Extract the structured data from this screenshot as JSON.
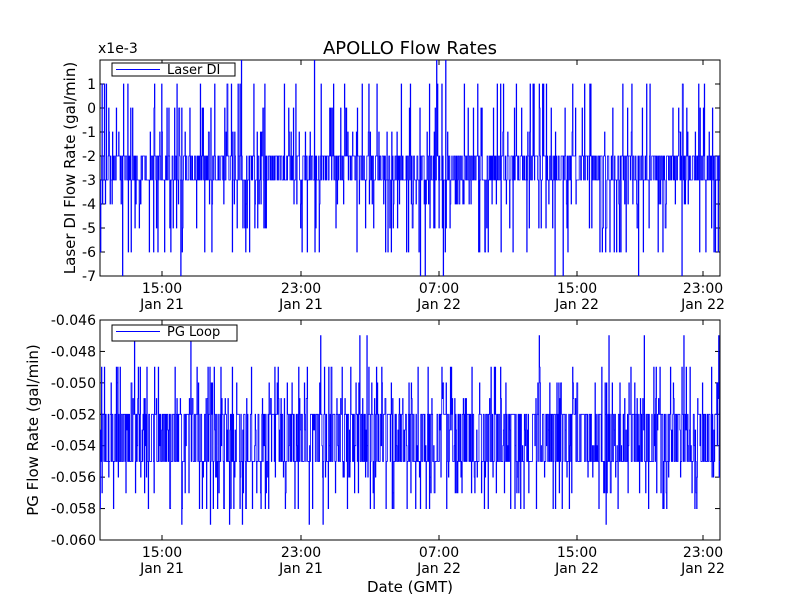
{
  "figure_title": "APOLLO Flow Rates",
  "colors": {
    "line": "#0000ff",
    "axes": "#000000",
    "background": "#ffffff"
  },
  "chart_data": [
    {
      "type": "line",
      "title": "APOLLO Flow Rates",
      "xlabel": "",
      "ylabel": "Laser DI Flow Rate (gal/min)",
      "y_scale_label": "x1e-3",
      "ylim": [
        -7,
        2
      ],
      "y_ticks": [
        1,
        0,
        -1,
        -2,
        -3,
        -4,
        -5,
        -6,
        -7
      ],
      "y_tick_labels": [
        "1",
        "0",
        "-1",
        "-2",
        "-3",
        "-4",
        "-5",
        "-6",
        "-7"
      ],
      "x_range": [
        "Jan 21 11:00",
        "Jan 22 23:30"
      ],
      "x_ticks": [
        {
          "time": "15:00",
          "date": "Jan 21"
        },
        {
          "time": "23:00",
          "date": "Jan 21"
        },
        {
          "time": "07:00",
          "date": "Jan 22"
        },
        {
          "time": "15:00",
          "date": "Jan 22"
        },
        {
          "time": "23:00",
          "date": "Jan 22"
        }
      ],
      "legend": {
        "placement": "top-left",
        "entries": [
          "Laser DI"
        ]
      },
      "grid": false,
      "series": [
        {
          "name": "Laser DI",
          "baseline_low": -3,
          "baseline_high": -2,
          "min": -7,
          "max": 2,
          "typical_values": [
            -2,
            -3,
            -1,
            -4,
            0,
            -2,
            -3,
            -5,
            1,
            -6
          ],
          "notes_from_plot": "noisy step signal oscillating mostly between -2 and -3 (x1e-3), spikes to 0/1 and dips to -6/-7"
        }
      ]
    },
    {
      "type": "line",
      "title": "",
      "xlabel": "Date (GMT)",
      "ylabel": "PG Flow Rate (gal/min)",
      "ylim": [
        -0.06,
        -0.046
      ],
      "y_ticks": [
        -0.046,
        -0.048,
        -0.05,
        -0.052,
        -0.054,
        -0.056,
        -0.058,
        -0.06
      ],
      "y_tick_labels": [
        "-0.046",
        "-0.048",
        "-0.050",
        "-0.052",
        "-0.054",
        "-0.056",
        "-0.058",
        "-0.060"
      ],
      "x_range": [
        "Jan 21 11:00",
        "Jan 22 23:30"
      ],
      "x_ticks": [
        {
          "time": "15:00",
          "date": "Jan 21"
        },
        {
          "time": "23:00",
          "date": "Jan 21"
        },
        {
          "time": "07:00",
          "date": "Jan 22"
        },
        {
          "time": "15:00",
          "date": "Jan 22"
        },
        {
          "time": "23:00",
          "date": "Jan 22"
        }
      ],
      "legend": {
        "placement": "top-left",
        "entries": [
          "PG Loop"
        ]
      },
      "grid": false,
      "series": [
        {
          "name": "PG Loop",
          "baseline_low": -0.055,
          "baseline_high": -0.052,
          "min": -0.059,
          "max": -0.047,
          "typical_values": [
            -0.053,
            -0.054,
            -0.052,
            -0.055,
            -0.056,
            -0.051,
            -0.057,
            -0.05,
            -0.058,
            -0.049
          ],
          "notes_from_plot": "dense noisy band between about -0.052 and -0.055, spikes up to -0.047 and down to -0.059"
        }
      ]
    }
  ]
}
